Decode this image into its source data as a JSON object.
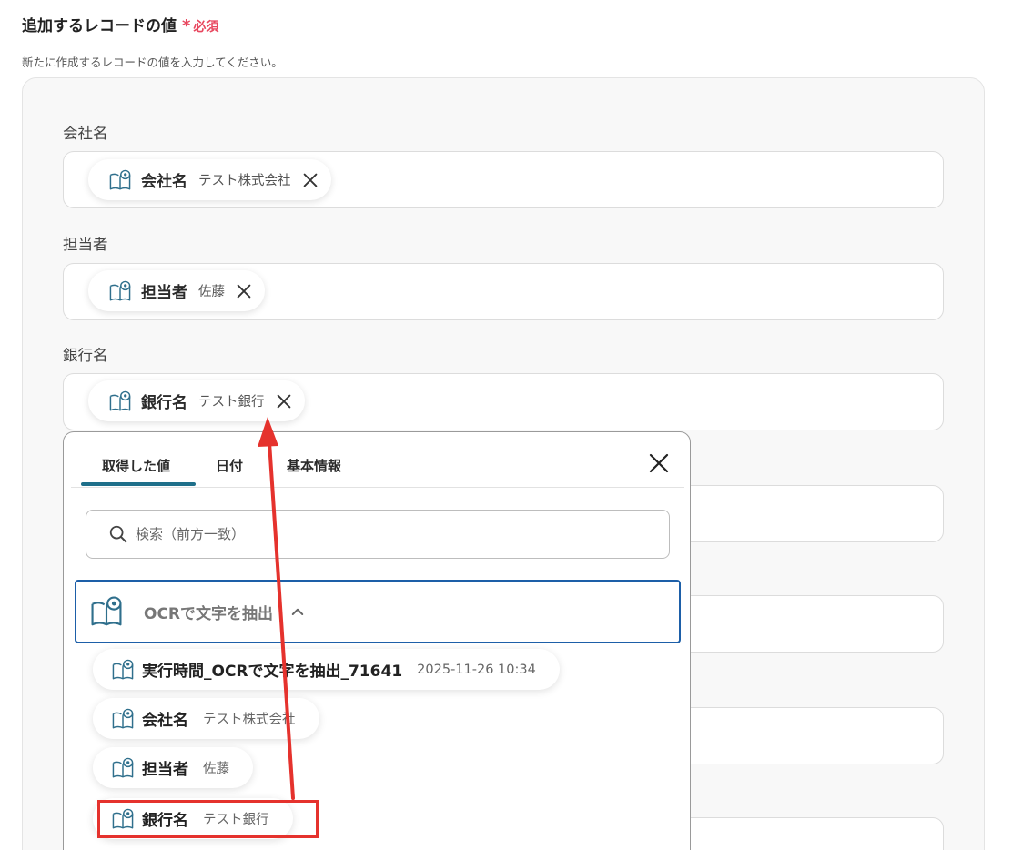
{
  "section": {
    "title": "追加するレコードの値",
    "required_mark": "*",
    "required_text": "必須",
    "description": "新たに作成するレコードの値を入力してください。"
  },
  "fields": [
    {
      "label": "会社名",
      "chip_name": "会社名",
      "chip_value": "テスト株式会社"
    },
    {
      "label": "担当者",
      "chip_name": "担当者",
      "chip_value": "佐藤"
    },
    {
      "label": "銀行名",
      "chip_name": "銀行名",
      "chip_value": "テスト銀行"
    }
  ],
  "popup": {
    "tabs": [
      "取得した値",
      "日付",
      "基本情報"
    ],
    "active_tab": "取得した値",
    "search_placeholder": "検索（前方一致）",
    "group_name": "OCRで文字を抽出",
    "options": [
      {
        "name": "実行時間_OCRで文字を抽出_71641",
        "value": "2025-11-26 10:34"
      },
      {
        "name": "会社名",
        "value": "テスト株式会社"
      },
      {
        "name": "担当者",
        "value": "佐藤"
      },
      {
        "name": "銀行名",
        "value": "テスト銀行"
      }
    ]
  },
  "colors": {
    "accent": "#1e6f8a",
    "required": "#e8475f",
    "annotation": "#e5322d",
    "group_border": "#1d5fa8"
  },
  "icons": {
    "chip": "book-eye-icon",
    "remove": "close-icon",
    "popup_close": "close-icon",
    "search": "search-icon",
    "collapse": "chevron-up-icon"
  }
}
